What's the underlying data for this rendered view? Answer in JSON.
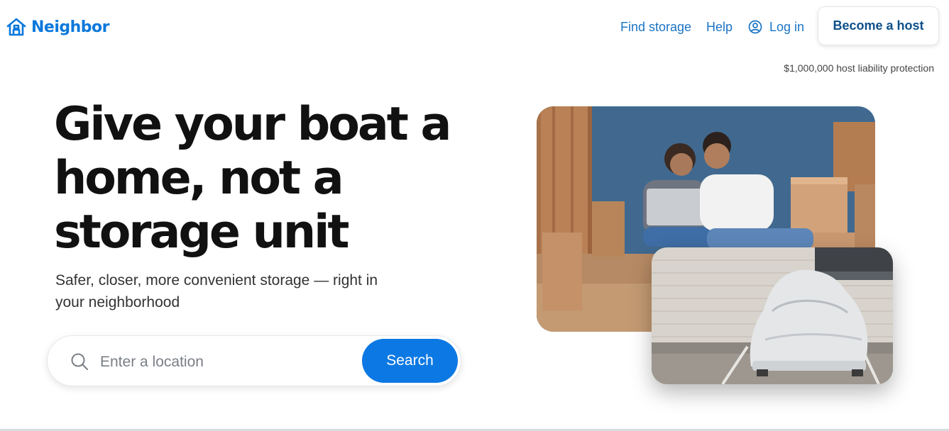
{
  "header": {
    "logo_text": "Neighbor",
    "nav": {
      "find_storage": "Find storage",
      "help": "Help",
      "log_in": "Log in"
    },
    "become_host": "Become a host",
    "liability_note": "$1,000,000 host liability protection"
  },
  "hero": {
    "title": "Give your boat a home, not a storage unit",
    "subtitle": "Safer, closer, more convenient storage — right in your neighborhood"
  },
  "search": {
    "placeholder": "Enter a location",
    "value": "",
    "button_label": "Search"
  },
  "colors": {
    "brand": "#0b78dc",
    "primary_button": "#0b78e3",
    "link": "#1b74c5",
    "title": "#111111"
  },
  "icons": {
    "logo": "house-logo-icon",
    "account": "user-circle-icon",
    "search": "search-icon"
  }
}
